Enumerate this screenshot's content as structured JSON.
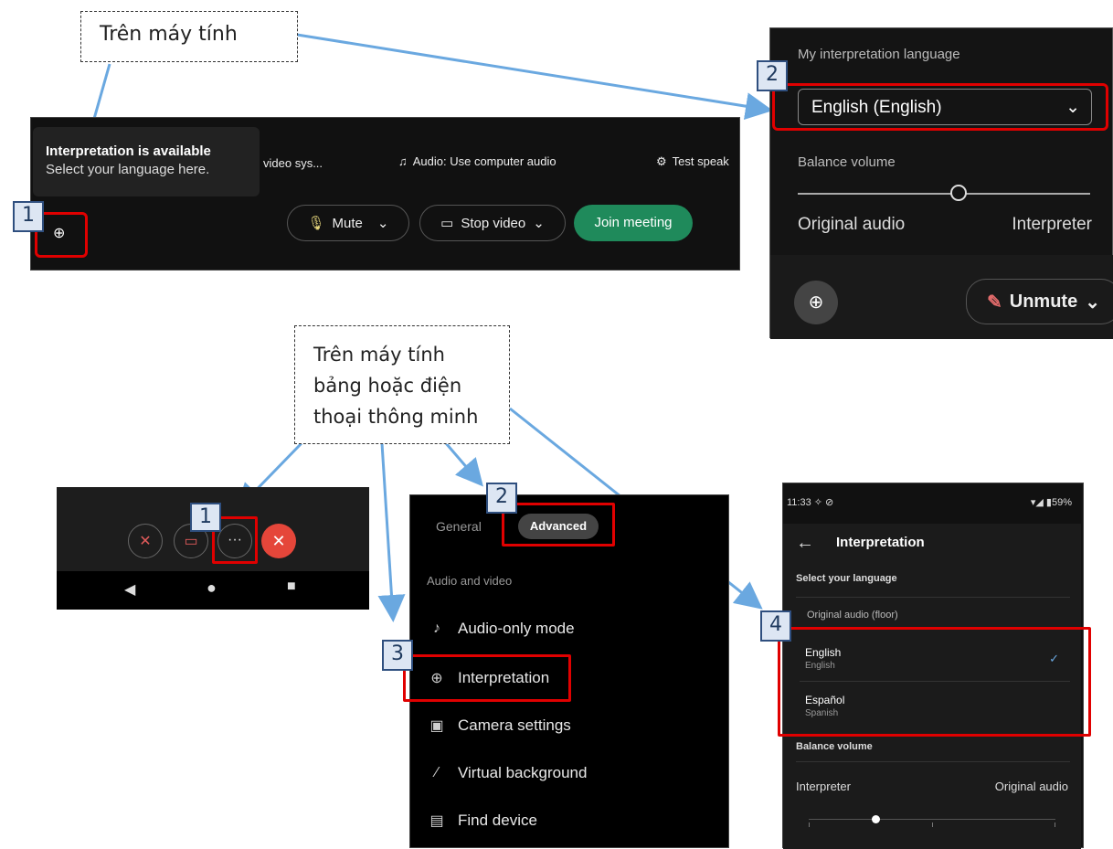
{
  "callouts": {
    "desktop": "Trên máy tính",
    "mobile": [
      "Trên máy tính",
      "bảng hoặc điện",
      "thoại thông minh"
    ]
  },
  "steps": {
    "one": "1",
    "two": "2",
    "three": "3",
    "four": "4"
  },
  "desktop_bar": {
    "tooltip_title": "Interpretation is available",
    "tooltip_sub": "Select your language here.",
    "video_sys": "video sys...",
    "audio_label": "Audio: Use computer audio",
    "test_speaker": "Test speak",
    "mute": "Mute",
    "stop_video": "Stop video",
    "join": "Join meeting"
  },
  "lang_panel": {
    "title": "My interpretation language",
    "selected": "English (English)",
    "balance": "Balance volume",
    "left": "Original audio",
    "right": "Interpreter",
    "unmute": "Unmute",
    "slider_level": 0.55
  },
  "mobile_settings": {
    "tab_general": "General",
    "tab_advanced": "Advanced",
    "section": "Audio and video",
    "items": [
      "Audio-only mode",
      "Interpretation",
      "Camera settings",
      "Virtual background",
      "Find device"
    ]
  },
  "phone": {
    "time": "11:33",
    "battery": "59%",
    "title": "Interpretation",
    "select_label": "Select your language",
    "original": "Original audio (floor)",
    "lang1_name": "English",
    "lang1_sub": "English",
    "lang2_name": "Español",
    "lang2_sub": "Spanish",
    "balance": "Balance volume",
    "interpreter": "Interpreter",
    "original_audio": "Original audio",
    "slider_level": 0.27
  },
  "colors": {
    "accent_red": "#e00000",
    "join_green": "#1f8a5b",
    "arrow_blue": "#6aa8e0",
    "end_call_red": "#e5463a"
  }
}
